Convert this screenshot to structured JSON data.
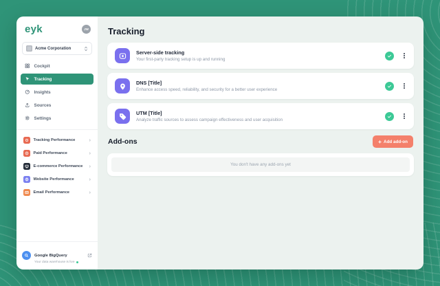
{
  "app": {
    "logo": "eyk",
    "avatar_initials": "JW"
  },
  "sidebar": {
    "company": {
      "name": "Acme Corporation"
    },
    "menu": [
      {
        "label": "Cockpit"
      },
      {
        "label": "Tracking",
        "selected": true
      },
      {
        "label": "Insights"
      },
      {
        "label": "Sources"
      },
      {
        "label": "Settings"
      }
    ],
    "performance": [
      {
        "label": "Tracking Performance",
        "color": "#E86A52"
      },
      {
        "label": "Paid Performance",
        "color": "#E86A52"
      },
      {
        "label": "E-commerce Performance",
        "color": "#262E3A"
      },
      {
        "label": "Website Performance",
        "color": "#7B80F0"
      },
      {
        "label": "Email Performance",
        "color": "#EF8A50"
      }
    ],
    "footer": {
      "title": "Google BigQuery",
      "subtitle": "Your data warehouse is live"
    }
  },
  "main": {
    "title": "Tracking",
    "cards": [
      {
        "title": "Server-side tracking",
        "description": "Your first-party tracking setup is up and running"
      },
      {
        "title": "DNS [Title]",
        "description": "Enhance access speed, reliability, and security for a better user experience"
      },
      {
        "title": "UTM [Title]",
        "description": "Analyze traffic sources to assess campaign effectiveness and user acquisition"
      }
    ],
    "addons": {
      "title": "Add-ons",
      "add_button": "Add add-on",
      "empty_message": "You don't have any add-ons yet"
    }
  },
  "colors": {
    "background_green": "#2F9478",
    "active_item_green": "#2F9478",
    "accent_purple": "#7A70EE",
    "success_green": "#3CC996",
    "button_salmon": "#F4806B",
    "bigquery_blue": "#4D90F0",
    "main_background": "#ECF2EF"
  }
}
